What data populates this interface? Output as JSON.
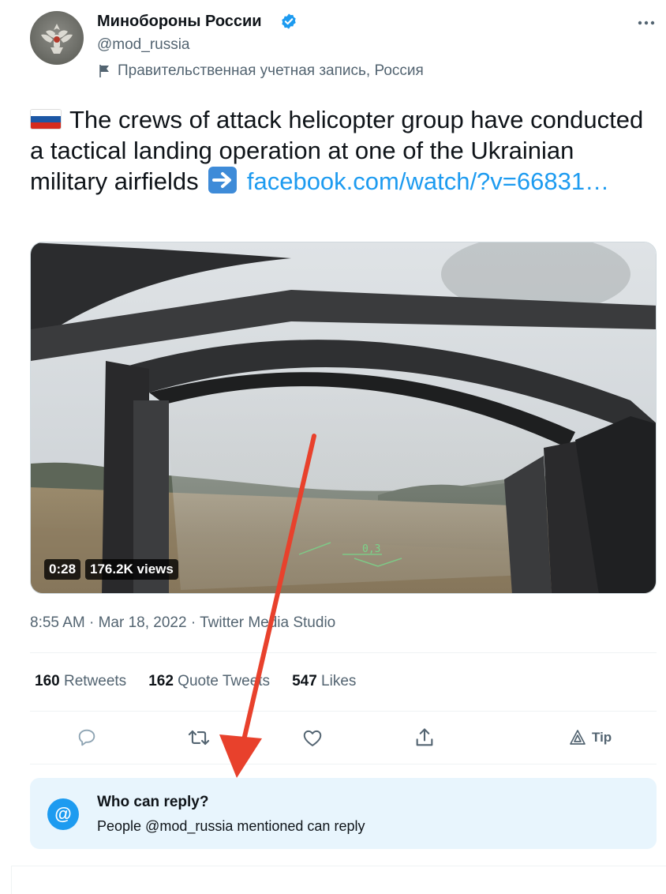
{
  "author": {
    "display_name": "Минобороны России",
    "handle": "@mod_russia",
    "account_label": "Правительственная учетная запись, Россия",
    "avatar_icon": "emblem-avatar-icon"
  },
  "tweet": {
    "text": "The crews of attack helicopter group have conducted a tactical landing operation at one of the Ukrainian military airfields",
    "link_text": "facebook.com/watch/?v=66831…",
    "emoji_flag": "russian-flag-emoji",
    "emoji_arrow": "right-arrow-emoji"
  },
  "media": {
    "duration": "0:28",
    "views": "176.2K views",
    "hud_text": "0,3"
  },
  "meta": {
    "timestamp": "8:55 AM · Mar 18, 2022 · Twitter Media Studio"
  },
  "stats": {
    "retweets_count": "160",
    "retweets_label": "Retweets",
    "quotes_count": "162",
    "quotes_label": "Quote Tweets",
    "likes_count": "547",
    "likes_label": "Likes"
  },
  "actions": {
    "tip_label": "Tip"
  },
  "reply_settings": {
    "title": "Who can reply?",
    "subtitle": "People @mod_russia mentioned can reply"
  },
  "colors": {
    "accent": "#1d9bf0",
    "secondary_text": "#536471",
    "annotation_arrow": "#e8412c"
  }
}
